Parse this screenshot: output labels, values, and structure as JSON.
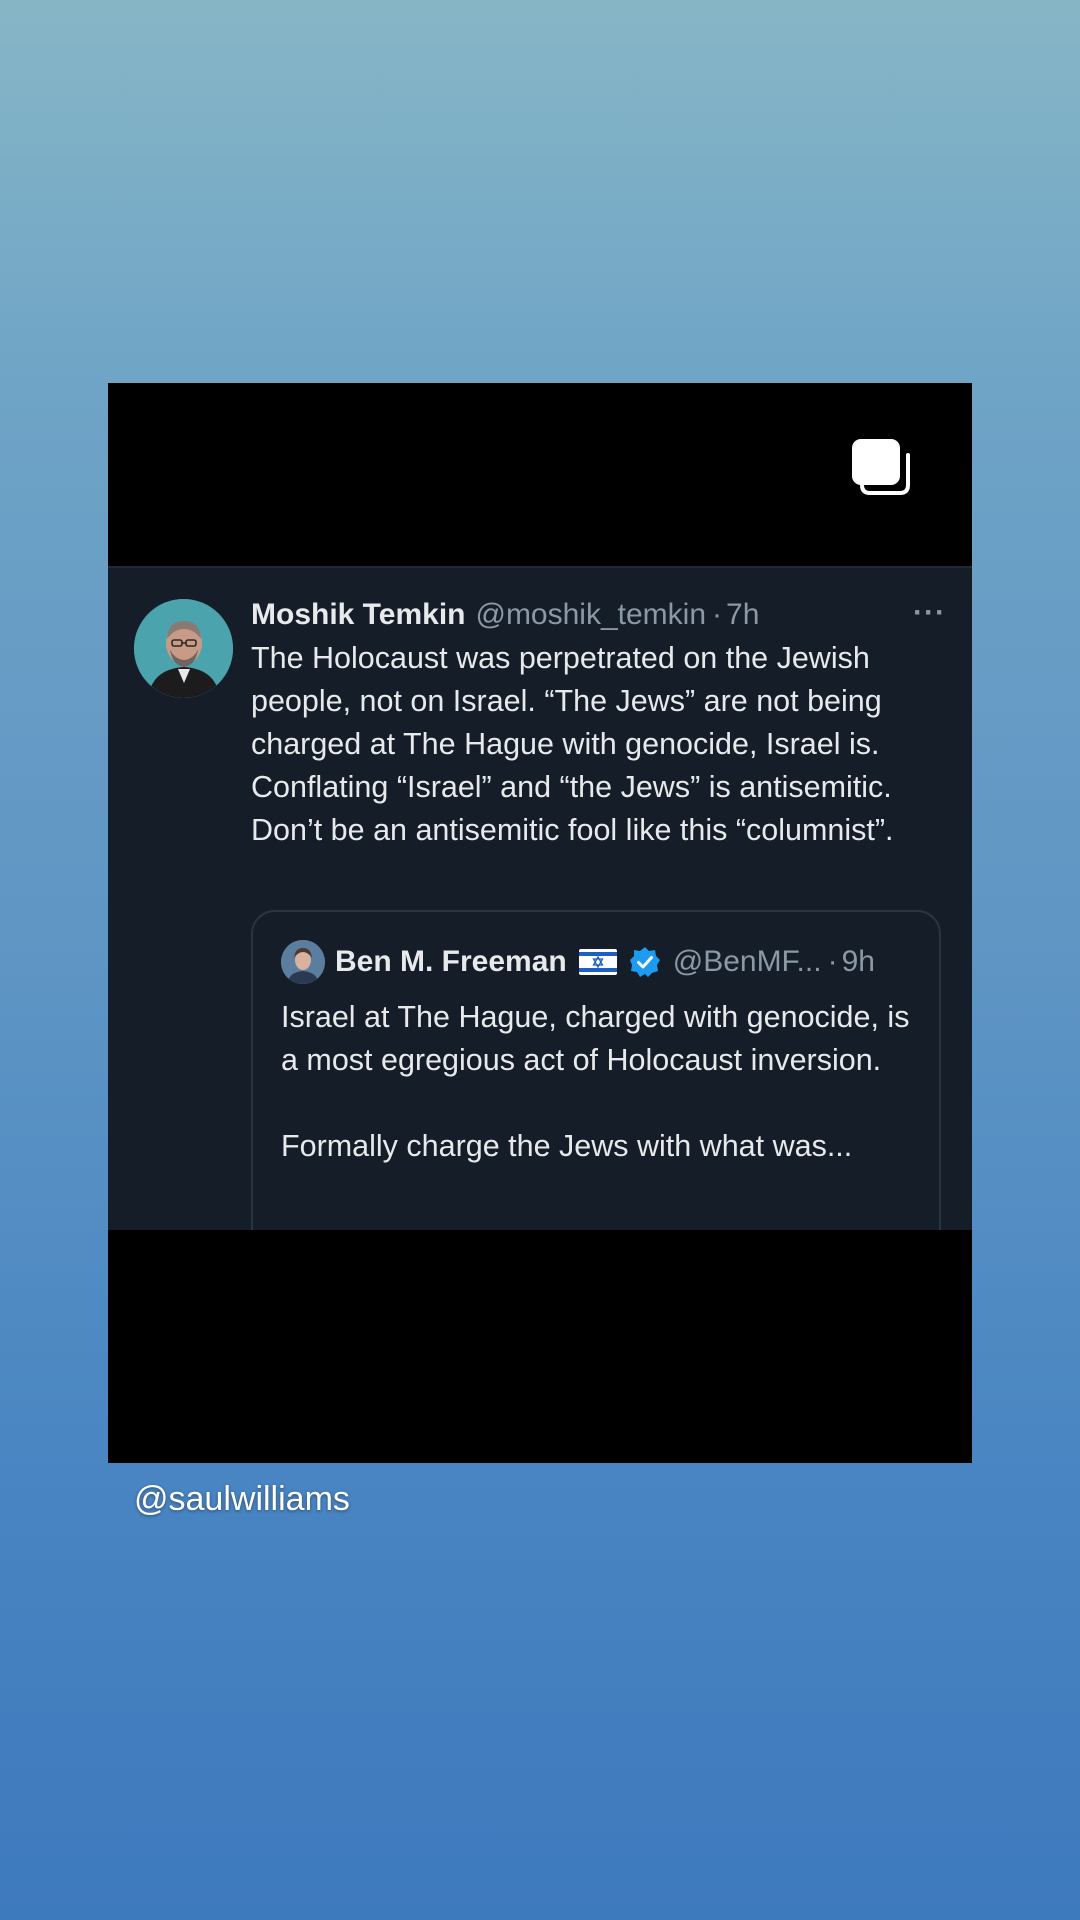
{
  "story": {
    "mention": "@saulwilliams"
  },
  "tweet": {
    "author_name": "Moshik Temkin",
    "author_handle": "@moshik_temkin",
    "separator": "·",
    "time": "7h",
    "more_label": "···",
    "text": "The Holocaust was perpetrated on the Jewish people, not on Israel. “The Jews” are not being charged at The Hague with genocide, Israel is. Conflating “Israel” and “the Jews” is antisemitic. Don’t be an antisemitic fool like this “columnist”.",
    "quote": {
      "author_name": "Ben M. Freeman",
      "author_handle": "@BenMF...",
      "separator": "·",
      "time": "9h",
      "paragraph1": "Israel at The Hague, charged with genocide, is a most egregious act of Holocaust inversion.",
      "paragraph2": "Formally charge the Jews with what was..."
    }
  },
  "icons": {
    "multi_post": "multiple-pages-icon",
    "flag": "israel-flag-icon",
    "verified": "verified-badge-icon"
  },
  "colors": {
    "tweet_bg": "#151d29",
    "text": "#e7e9ea",
    "secondary_text": "#8b98a5",
    "verified_blue": "#1d9bf0"
  }
}
